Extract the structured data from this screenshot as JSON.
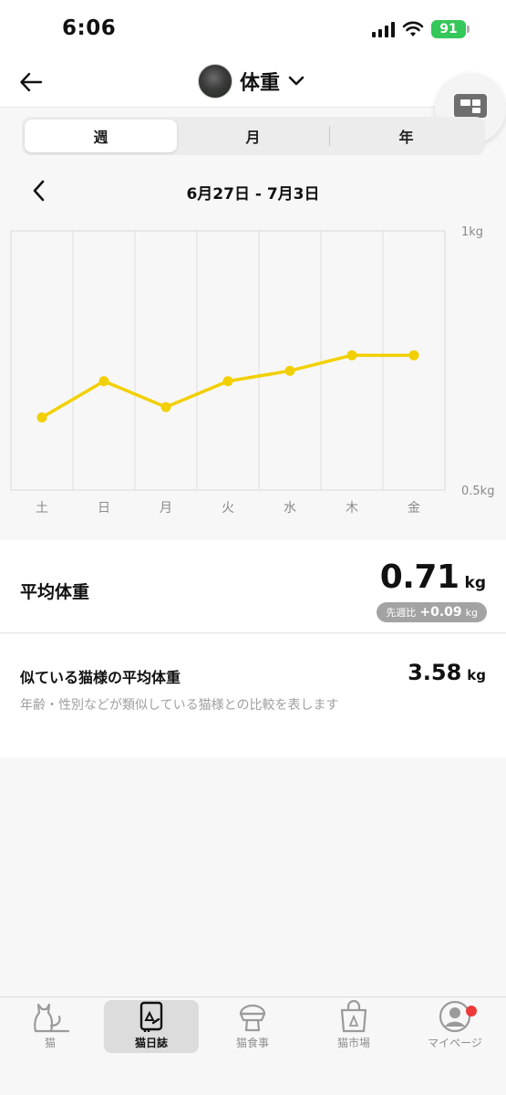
{
  "status_bar": {
    "time": "6:06",
    "battery": "91"
  },
  "header": {
    "title": "体重"
  },
  "period_tabs": [
    {
      "label": "週",
      "active": true
    },
    {
      "label": "月",
      "active": false
    },
    {
      "label": "年",
      "active": false
    }
  ],
  "date_range": "6月27日 - 7月3日",
  "chart_data": {
    "type": "line",
    "categories": [
      "土",
      "日",
      "月",
      "火",
      "水",
      "木",
      "金"
    ],
    "series": [
      {
        "values": [
          0.64,
          0.71,
          0.66,
          0.71,
          0.73,
          0.76,
          0.76
        ],
        "color": "#f2d000"
      }
    ],
    "ylim": [
      0.5,
      1.0
    ],
    "y_tick_labels": {
      "top": "1kg",
      "bottom": "0.5kg"
    },
    "grid": true
  },
  "average": {
    "label": "平均体重",
    "value": "0.71",
    "unit": "kg",
    "diff_prefix": "先週比",
    "diff_value": "+0.09",
    "diff_unit": "kg"
  },
  "similar": {
    "label": "似ている猫様の平均体重",
    "value": "3.58",
    "unit": "kg",
    "description": "年齢・性別などが類似している猫様との比較を表します"
  },
  "tabbar": [
    {
      "label": "猫",
      "icon": "cat-icon",
      "active": false
    },
    {
      "label": "猫日誌",
      "icon": "diary-icon",
      "active": true
    },
    {
      "label": "猫食事",
      "icon": "food-bowl-icon",
      "active": false
    },
    {
      "label": "猫市場",
      "icon": "shopping-bag-icon",
      "active": false
    },
    {
      "label": "マイページ",
      "icon": "profile-icon",
      "active": false,
      "badge": true
    }
  ],
  "colors": {
    "accent": "#f2d000",
    "badge": "#ef3a3a"
  }
}
